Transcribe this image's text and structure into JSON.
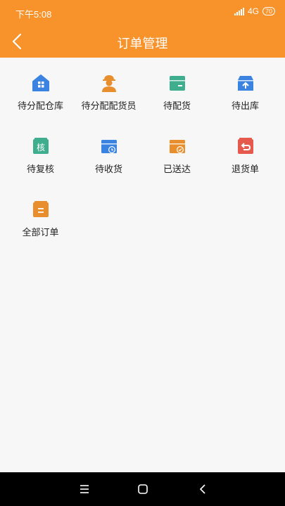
{
  "status": {
    "time": "下午5:08",
    "network": "4G",
    "battery": "70"
  },
  "header": {
    "title": "订单管理"
  },
  "items": [
    {
      "label": "待分配仓库",
      "icon": "warehouse-icon",
      "color": "#3b83e0"
    },
    {
      "label": "待分配配货员",
      "icon": "worker-icon",
      "color": "#e98e2c"
    },
    {
      "label": "待配货",
      "icon": "box-icon",
      "color": "#3fae8e"
    },
    {
      "label": "待出库",
      "icon": "outbound-box-icon",
      "color": "#3b83e0"
    },
    {
      "label": "待复核",
      "icon": "review-icon",
      "color": "#3fae8e",
      "glyph": "核"
    },
    {
      "label": "待收货",
      "icon": "receive-clock-icon",
      "color": "#3b83e0"
    },
    {
      "label": "已送达",
      "icon": "delivered-check-icon",
      "color": "#e98e2c"
    },
    {
      "label": "退货单",
      "icon": "return-icon",
      "color": "#e65a4d"
    },
    {
      "label": "全部订单",
      "icon": "all-orders-icon",
      "color": "#e98e2c"
    }
  ],
  "colors": {
    "accent": "#f8922a",
    "background": "#f7f7f7",
    "navbar": "#000000"
  }
}
